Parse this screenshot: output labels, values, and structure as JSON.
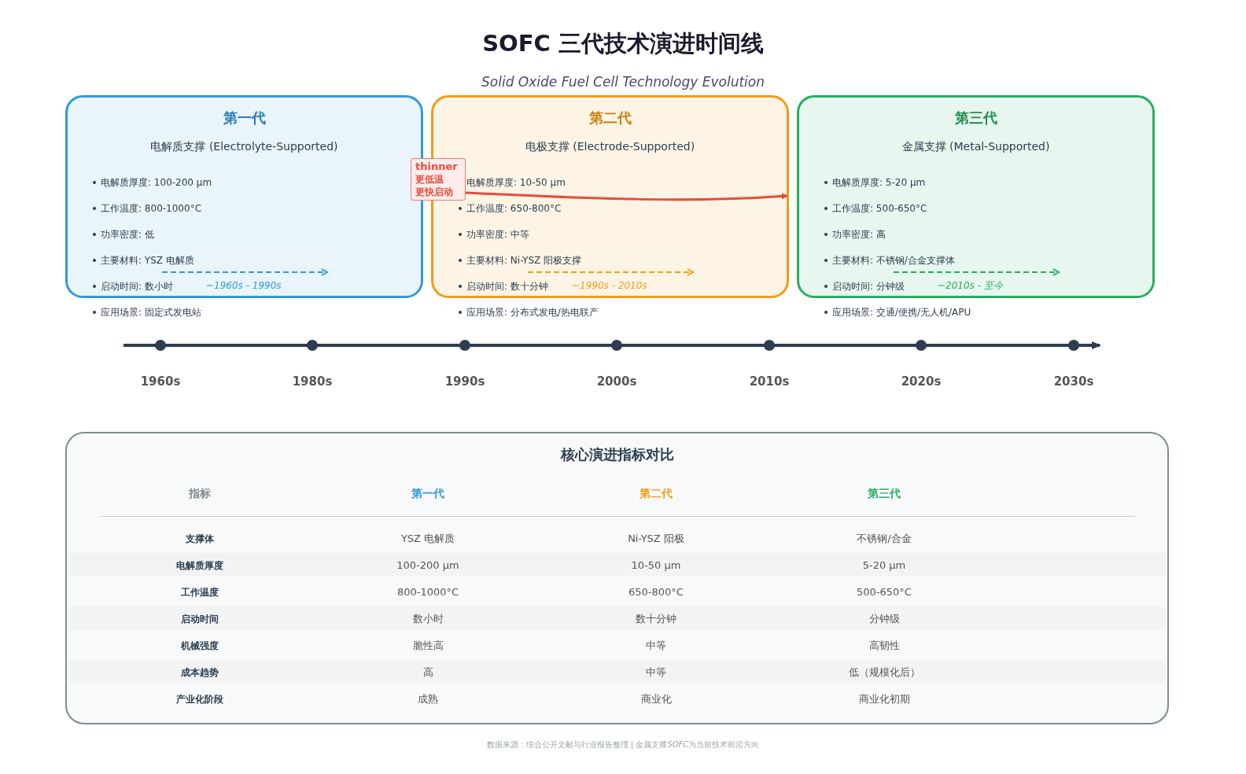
{
  "title": "SOFC 三代技术演进时间线",
  "subtitle": "Solid Oxide Fuel Cell Technology Evolution",
  "generations": [
    {
      "name": "第一代",
      "color": "#3498db",
      "support": "电解质支撑 (Electrolyte-Supported)",
      "specs": [
        "电解质厚度: 100-200 μm",
        "工作温度: 800-1000°C",
        "功率密度: 低",
        "主要材料: YSZ 电解质",
        "启动时间: 数小时",
        "应用场景: 固定式发电站"
      ],
      "period": "~1960s - 1990s"
    },
    {
      "name": "第二代",
      "color": "#f39c12",
      "support": "电极支撑 (Electrode-Supported)",
      "specs": [
        "电解质厚度: 10-50 μm",
        "工作温度: 650-800°C",
        "功率密度: 中等",
        "主要材料: Ni-YSZ 阳极支撑",
        "启动时间: 数十分钟",
        "应用场景: 分布式发电/热电联产"
      ],
      "period": "~1990s - 2010s"
    },
    {
      "name": "第三代",
      "color": "#27ae60",
      "support": "金属支撑 (Metal-Supported)",
      "specs": [
        "电解质厚度: 5-20 μm",
        "工作温度: 500-650°C",
        "功率密度: 高",
        "主要材料: 不锈钢/合金支撑体",
        "启动时间: 分钟级",
        "应用场景: 交通/便携/无人机/APU"
      ],
      "period": "~2010s - 至今"
    }
  ],
  "annotation": {
    "lines": [
      "thinner",
      "更低温",
      "更快启动"
    ]
  },
  "timeline": {
    "labels": [
      "1960s",
      "1980s",
      "1990s",
      "2000s",
      "2010s",
      "2020s",
      "2030s"
    ]
  },
  "comparison": {
    "title": "核心演进指标对比",
    "columns": [
      {
        "label": "指标",
        "color": "#7f8c8d"
      },
      {
        "label": "第一代",
        "color": "#3498db"
      },
      {
        "label": "第二代",
        "color": "#f39c12"
      },
      {
        "label": "第三代",
        "color": "#27ae60"
      }
    ],
    "rows": [
      {
        "cells": [
          "支撑体",
          "YSZ 电解质",
          "Ni-YSZ 阳极",
          "不锈钢/合金"
        ]
      },
      {
        "cells": [
          "电解质厚度",
          "100-200 μm",
          "10-50 μm",
          "5-20 μm"
        ]
      },
      {
        "cells": [
          "工作温度",
          "800-1000°C",
          "650-800°C",
          "500-650°C"
        ]
      },
      {
        "cells": [
          "启动时间",
          "数小时",
          "数十分钟",
          "分钟级"
        ]
      },
      {
        "cells": [
          "机械强度",
          "脆性高",
          "中等",
          "高韧性"
        ]
      },
      {
        "cells": [
          "成本趋势",
          "高",
          "中等",
          "低（规模化后）"
        ]
      },
      {
        "cells": [
          "产业化阶段",
          "成熟",
          "商业化",
          "商业化初期"
        ]
      }
    ]
  },
  "footer": [
    {
      "text": "数据来源：综合公开文献与行业报告整理 | 金属支撑",
      "italic": false
    },
    {
      "text": "SOFC",
      "italic": true
    },
    {
      "text": "为当前技术前沿方向",
      "italic": false
    }
  ]
}
